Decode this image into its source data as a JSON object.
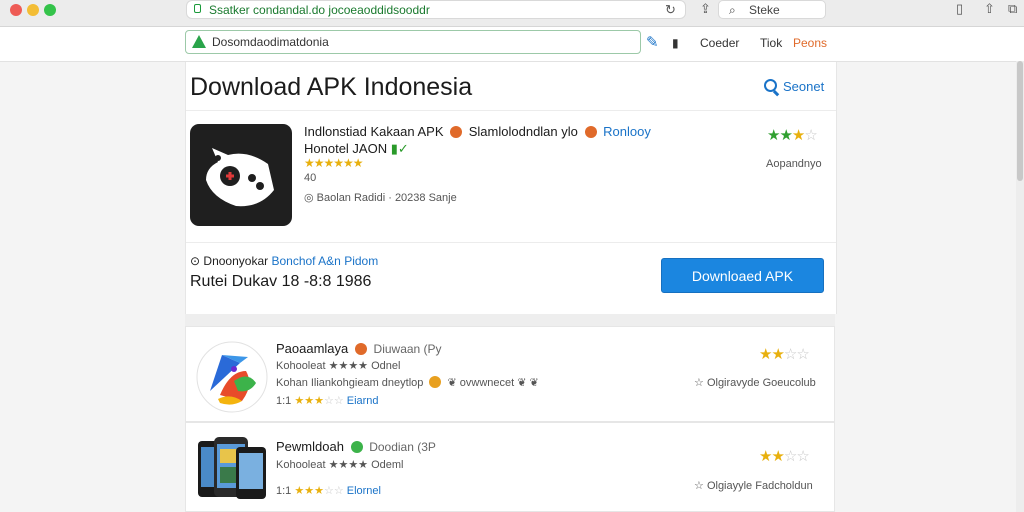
{
  "browser": {
    "url": "Ssatker condandal.do jocoeaoddidsooddr",
    "search_label": "Steke"
  },
  "nav": {
    "address_text": "Dosomdaodimatdonia",
    "links": [
      "Coeder",
      "Tiok",
      "Peons"
    ],
    "accent_color": "#e06a2a"
  },
  "page": {
    "title": "Download APK Indonesia",
    "search_label": "Seonet"
  },
  "featured": {
    "name": "Indlonstiad Kakaan APK",
    "name_suffix": "Slamlolodndlan ylo",
    "publisher": "Ronlooy",
    "subtitle": "Honotel JAON",
    "review_count": "40",
    "info": "Baolan Radidi  ·  20238 Sanje",
    "rating_stars": 2.5,
    "rating_label": "Aopandnyo",
    "meta_label": "Dnoonyokar",
    "meta_link": "Bonchof A&n Pidom",
    "update_line": "Rutei Dukav 18 -8:8 1986",
    "download_label": "Downloaed APK"
  },
  "apps": [
    {
      "name": "Paoaamlaya",
      "badge": "Diuwaan (Py",
      "line1": "Kohooleat ★★★★ Odnel",
      "line2": "Kohan Iliankohgieam dneytlop",
      "line2_suffix": "ovwwnecet",
      "count": "1:1",
      "link": "Eiarnd",
      "rating_stars": 2,
      "right_label": "Olgiravyde Goeucolub"
    },
    {
      "name": "Pewmldoah",
      "badge": "Doodian (3P",
      "line1": "Kohooleat ★★★★ Odeml",
      "count": "1:1",
      "link": "Elornel",
      "rating_stars": 2,
      "right_label": "Olgiayyle Fadcholdun"
    }
  ]
}
